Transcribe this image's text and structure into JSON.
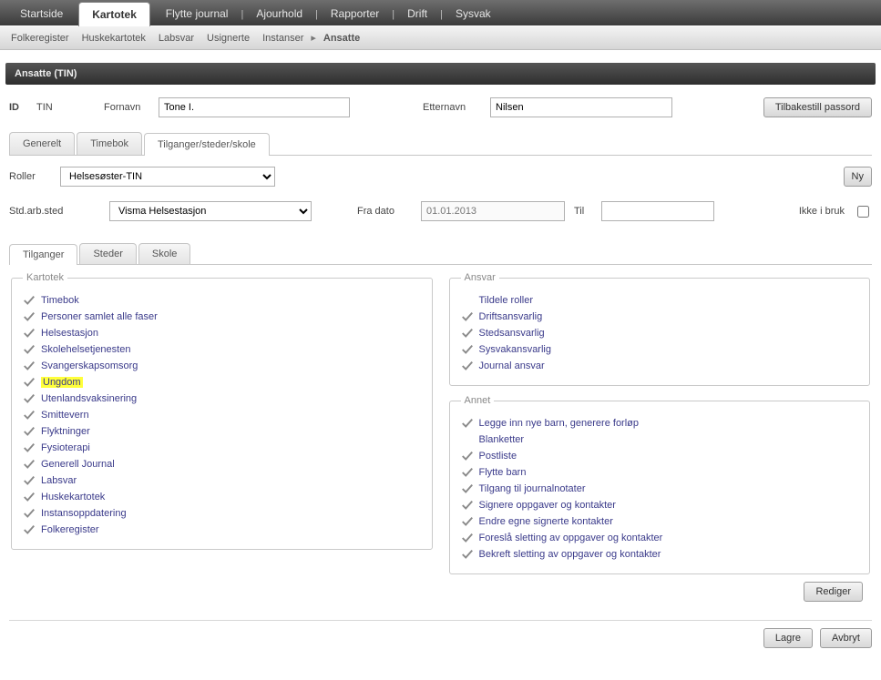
{
  "topnav": {
    "items": [
      "Startside",
      "Kartotek",
      "Flytte journal",
      "Ajourhold",
      "Rapporter",
      "Drift",
      "Sysvak"
    ],
    "active_index": 1
  },
  "subnav": {
    "items": [
      "Folkeregister",
      "Huskekartotek",
      "Labsvar",
      "Usignerte",
      "Instanser"
    ],
    "current_label": "Ansatte"
  },
  "titlebar": "Ansatte (TIN)",
  "form": {
    "id_label": "ID",
    "tin_label": "TIN",
    "fornavn_label": "Fornavn",
    "fornavn_value": "Tone I.",
    "etternavn_label": "Etternavn",
    "etternavn_value": "Nilsen",
    "reset_btn": "Tilbakestill passord"
  },
  "tabs2": {
    "items": [
      "Generelt",
      "Timebok",
      "Tilganger/steder/skole"
    ],
    "active_index": 2
  },
  "roller": {
    "label": "Roller",
    "value": "Helsesøster-TIN",
    "ny_btn": "Ny"
  },
  "std": {
    "label": "Std.arb.sted",
    "value": "Visma Helsestasjon",
    "fra_label": "Fra dato",
    "fra_value": "01.01.2013",
    "til_label": "Til",
    "til_value": "",
    "ikkebruk_label": "Ikke i bruk",
    "ikkebruk_checked": false
  },
  "tabs3": {
    "items": [
      "Tilganger",
      "Steder",
      "Skole"
    ],
    "active_index": 0
  },
  "groups": {
    "kartotek": {
      "legend": "Kartotek",
      "items": [
        {
          "label": "Timebok",
          "checked": true
        },
        {
          "label": "Personer samlet alle faser",
          "checked": true
        },
        {
          "label": "Helsestasjon",
          "checked": true
        },
        {
          "label": "Skolehelsetjenesten",
          "checked": true
        },
        {
          "label": "Svangerskapsomsorg",
          "checked": true
        },
        {
          "label": "Ungdom",
          "checked": true,
          "highlight": true
        },
        {
          "label": "Utenlandsvaksinering",
          "checked": true
        },
        {
          "label": "Smittevern",
          "checked": true
        },
        {
          "label": "Flyktninger",
          "checked": true
        },
        {
          "label": "Fysioterapi",
          "checked": true
        },
        {
          "label": "Generell Journal",
          "checked": true
        },
        {
          "label": "Labsvar",
          "checked": true
        },
        {
          "label": "Huskekartotek",
          "checked": true
        },
        {
          "label": "Instansoppdatering",
          "checked": true
        },
        {
          "label": "Folkeregister",
          "checked": true
        }
      ]
    },
    "ansvar": {
      "legend": "Ansvar",
      "items": [
        {
          "label": "Tildele roller",
          "checked": false
        },
        {
          "label": "Driftsansvarlig",
          "checked": true
        },
        {
          "label": "Stedsansvarlig",
          "checked": true
        },
        {
          "label": "Sysvakansvarlig",
          "checked": true
        },
        {
          "label": "Journal ansvar",
          "checked": true
        }
      ]
    },
    "annet": {
      "legend": "Annet",
      "items": [
        {
          "label": "Legge inn nye barn, generere forløp",
          "checked": true
        },
        {
          "label": "Blanketter",
          "checked": false
        },
        {
          "label": "Postliste",
          "checked": true
        },
        {
          "label": "Flytte barn",
          "checked": true
        },
        {
          "label": "Tilgang til journalnotater",
          "checked": true
        },
        {
          "label": "Signere oppgaver og kontakter",
          "checked": true
        },
        {
          "label": "Endre egne signerte kontakter",
          "checked": true
        },
        {
          "label": "Foreslå sletting av oppgaver og kontakter",
          "checked": true
        },
        {
          "label": "Bekreft sletting av oppgaver og kontakter",
          "checked": true
        }
      ]
    }
  },
  "buttons": {
    "rediger": "Rediger",
    "lagre": "Lagre",
    "avbryt": "Avbryt"
  }
}
